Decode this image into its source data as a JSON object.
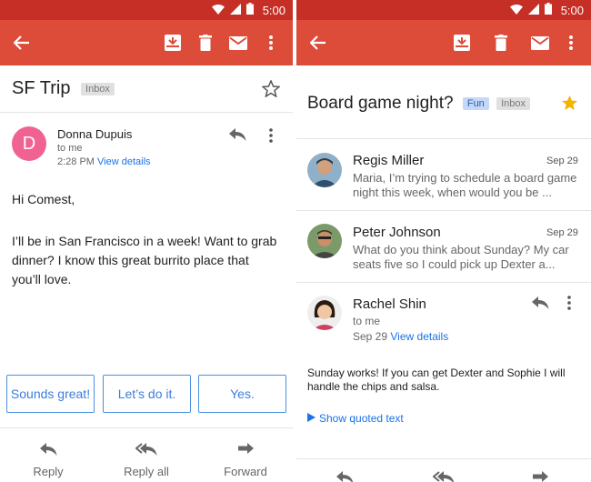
{
  "left": {
    "status_time": "5:00",
    "subject": "SF Trip",
    "label": "Inbox",
    "sender": {
      "initial": "D",
      "name": "Donna Dupuis",
      "to": "to me",
      "time": "2:28 PM",
      "view_details": "View details"
    },
    "body": {
      "greeting": "Hi Comest,",
      "line1": "I’ll be in San Francisco in a week! Want to grab",
      "line2": "dinner? I know this great burrito place that",
      "line3": "you’ll love."
    },
    "smart_replies": [
      "Sounds great!",
      "Let’s do it.",
      "Yes."
    ],
    "actions": {
      "reply": "Reply",
      "reply_all": "Reply all",
      "forward": "Forward"
    }
  },
  "right": {
    "status_time": "5:00",
    "subject": "Board game night?",
    "labels": [
      "Fun",
      "Inbox"
    ],
    "messages": [
      {
        "name": "Regis Miller",
        "date": "Sep 29",
        "preview_line1": "Maria, I’m trying to schedule a board game",
        "preview_line2": "night this week, when would you be ..."
      },
      {
        "name": "Peter Johnson",
        "date": "Sep 29",
        "preview_line1": "What do you think about Sunday? My car",
        "preview_line2": "seats five so I could pick up Dexter a..."
      }
    ],
    "open_message": {
      "name": "Rachel Shin",
      "to": "to me",
      "date": "Sep 29",
      "view_details": "View details",
      "body_line1": "Sunday works! If you can get Dexter and Sophie I will",
      "body_line2": "handle the chips and salsa.",
      "show_quoted": "Show quoted text"
    }
  },
  "colors": {
    "appbar": "#dd4b39",
    "statusbar": "#c62f25",
    "link": "#1a73e8",
    "star": "#f4b400"
  }
}
